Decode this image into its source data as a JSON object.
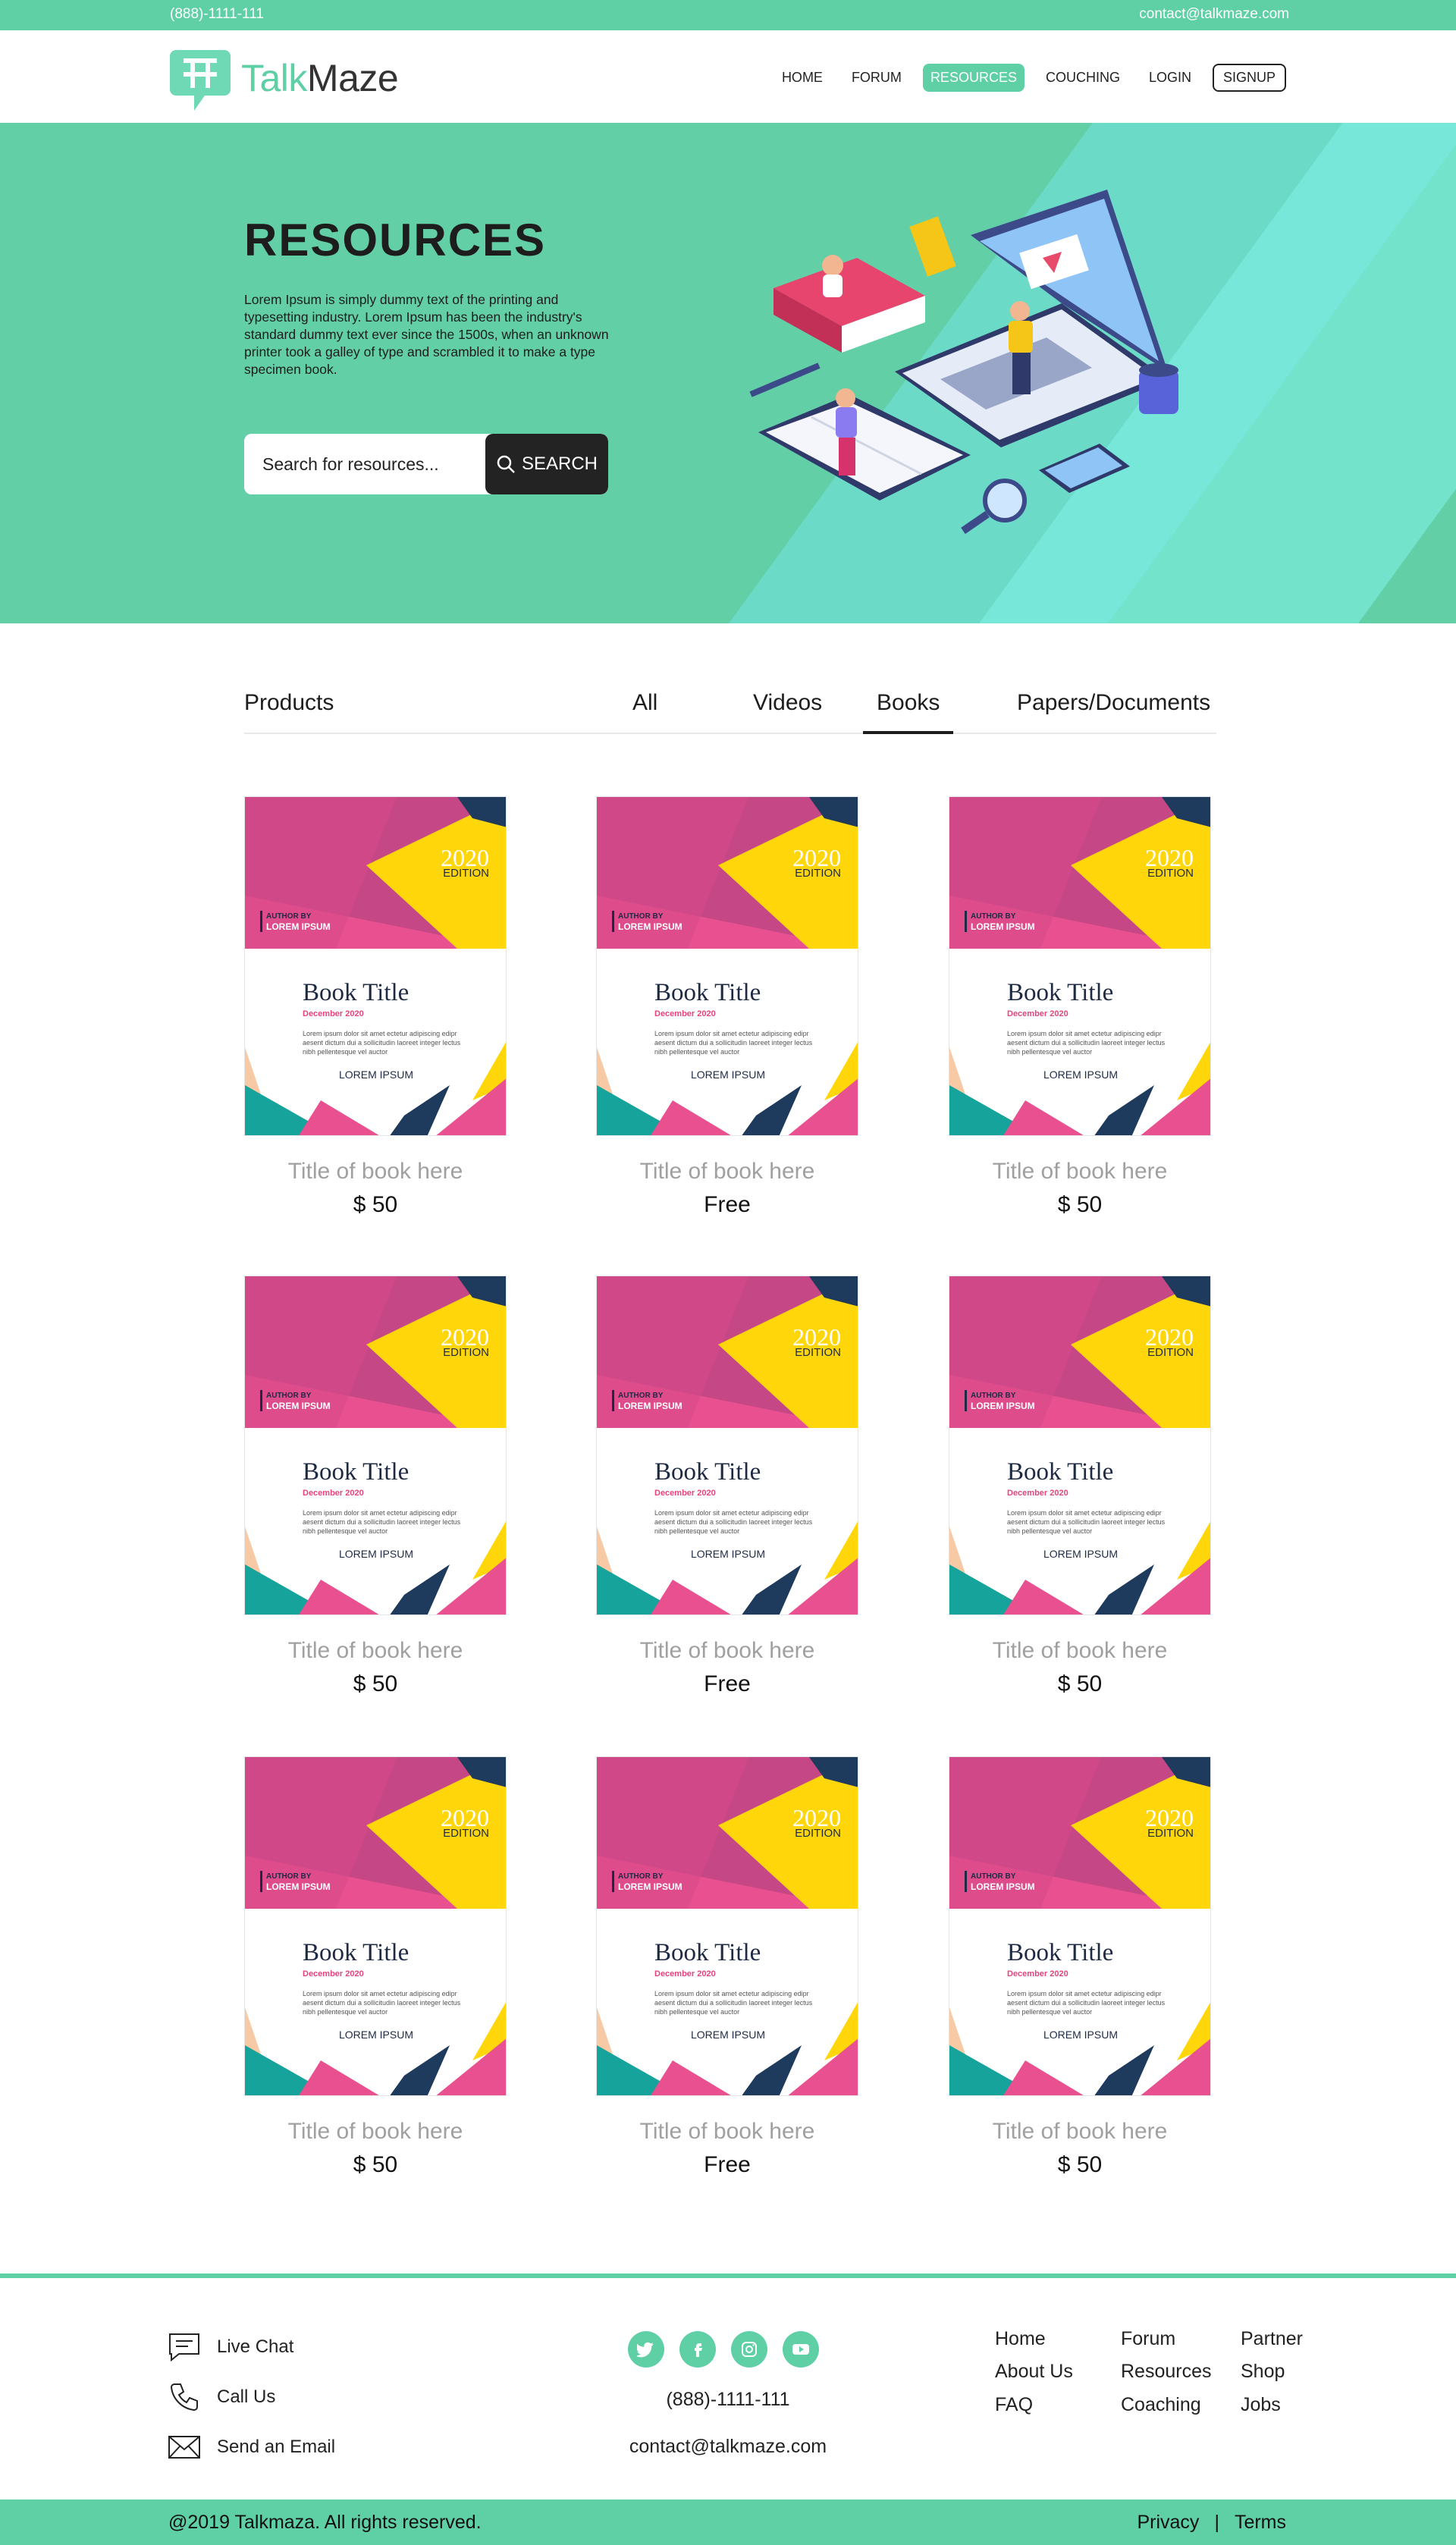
{
  "topbar": {
    "phone": "(888)-1111-111",
    "email": "contact@talkmaze.com"
  },
  "brand": {
    "name_part1": "Talk",
    "name_part2": "Maze",
    "accent_color": "#5fcfa6"
  },
  "nav": {
    "home": "HOME",
    "forum": "FORUM",
    "resources": "RESOURCES",
    "couching": "COUCHING",
    "login": "LOGIN",
    "signup": "SIGNUP",
    "active": "RESOURCES"
  },
  "hero": {
    "title": "RESOURCES",
    "text": "Lorem Ipsum is simply dummy text of the printing and typesetting industry. Lorem Ipsum has been the industry's standard dummy text ever since the 1500s, when an unknown printer took a galley of type and scrambled it to make a type specimen book.",
    "search_placeholder": "Search for resources...",
    "search_button": "SEARCH",
    "illustration_icon": "laptop-study-illustration"
  },
  "tabs": {
    "heading": "Products",
    "items": [
      "All",
      "Videos",
      "Books",
      "Papers/Documents"
    ],
    "active": "Books"
  },
  "cover": {
    "year": "2020",
    "edition": "EDITION",
    "author_by": "AUTHOR BY",
    "author_name": "LOREM IPSUM",
    "title": "Book Title",
    "date": "December 2020",
    "body": "Lorem ipsum dolor sit amet ectetur adipiscing edipr aesent dictum dui a sollicitudin laoreet integer lectus nibh pellentesque vel auctor",
    "author_footer": "LOREM IPSUM"
  },
  "products": [
    {
      "title": "Title of book here",
      "price": "$ 50"
    },
    {
      "title": "Title of book here",
      "price": "Free"
    },
    {
      "title": "Title of book here",
      "price": "$ 50"
    },
    {
      "title": "Title of book here",
      "price": "$ 50"
    },
    {
      "title": "Title of book here",
      "price": "Free"
    },
    {
      "title": "Title of book here",
      "price": "$ 50"
    },
    {
      "title": "Title of book here",
      "price": "$ 50"
    },
    {
      "title": "Title of book here",
      "price": "Free"
    },
    {
      "title": "Title of book here",
      "price": "$ 50"
    }
  ],
  "footer": {
    "live_chat": "Live Chat",
    "call_us": "Call Us",
    "send_email": "Send an Email",
    "socials": [
      "twitter-icon",
      "facebook-icon",
      "instagram-icon",
      "youtube-icon"
    ],
    "phone": "(888)-1111-111",
    "email": "contact@talkmaze.com",
    "links_col1": [
      "Home",
      "About Us",
      "FAQ"
    ],
    "links_col2": [
      "Forum",
      "Resources",
      "Coaching"
    ],
    "links_col3": [
      "Partner",
      "Shop",
      "Jobs"
    ],
    "copyright": "@2019 Talkmaza. All rights reserved.",
    "privacy": "Privacy",
    "separator": "|",
    "terms": "Terms"
  }
}
